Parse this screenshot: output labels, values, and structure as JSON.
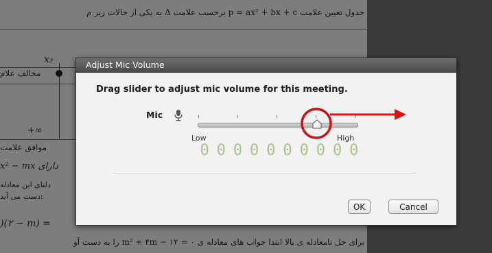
{
  "background": {
    "line1_text": "جدول تعیین علامت p = ax² + bx + c برحسب علامت Δ به یکی از حالات زیر م",
    "x2_label": "x₂",
    "opposite_label": "مخالف علام",
    "infinity_label": "+∞",
    "agree_label": "موافق علامت",
    "has_label": "x² − mx دارای",
    "delta_label": "دلتای این معادله",
    "result_label": "دست می آید:",
    "eq2_label": ")(۲ − m) =",
    "last_line": "برای حل نامعادله ی بالا ابتدا جواب های معادله ی ۰ = ۱۲ − m² + ۴m را به دست آو"
  },
  "dialog": {
    "title": "Adjust Mic Volume",
    "instruction": "Drag slider to adjust mic volume for this meeting.",
    "mic_label": "Mic",
    "low_label": "Low",
    "high_label": "High",
    "meter_digits": [
      "0",
      "0",
      "0",
      "0",
      "0",
      "0",
      "0",
      "0",
      "0",
      "0"
    ],
    "slider_level": 0.76,
    "ok_label": "OK",
    "cancel_label": "Cancel"
  },
  "icons": {
    "mic": "microphone-icon",
    "thumb": "slider-thumb"
  },
  "colors": {
    "annotation": "#c81414",
    "meter": "#a7c28a"
  }
}
